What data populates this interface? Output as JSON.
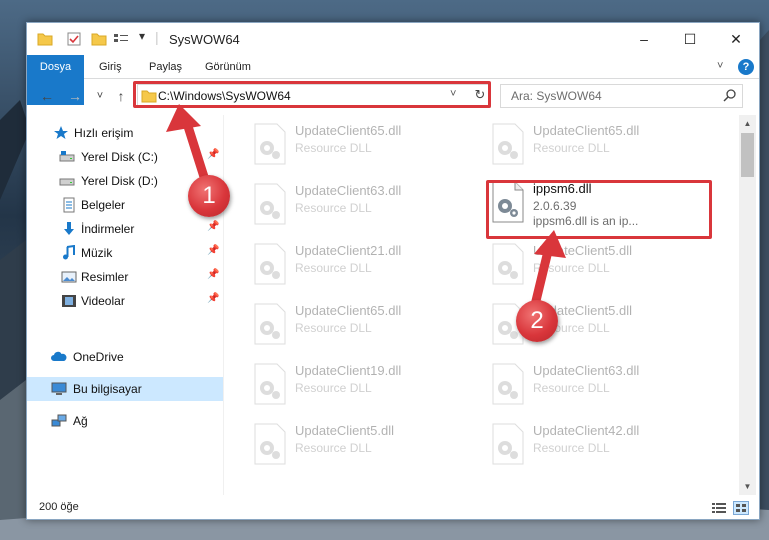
{
  "window": {
    "title": "SysWOW64",
    "minimize": "–",
    "maximize": "☐",
    "close": "✕"
  },
  "ribbon": {
    "tabs": [
      "Dosya",
      "Giriş",
      "Paylaş",
      "Görünüm"
    ],
    "help": "?"
  },
  "navigation": {
    "back": "←",
    "forward": "→",
    "recent": "˅",
    "up": "↑",
    "address": "C:\\Windows\\SysWOW64",
    "address_dropdown": "˅",
    "refresh": "↻",
    "search_placeholder": "Ara: SysWOW64"
  },
  "sidebar": {
    "items": [
      {
        "label": "Hızlı erişim",
        "icon": "star-icon"
      },
      {
        "label": "Yerel Disk (C:)",
        "icon": "drive-icon",
        "pinned": true
      },
      {
        "label": "Yerel Disk (D:)",
        "icon": "drive-icon",
        "pinned": false
      },
      {
        "label": "Belgeler",
        "icon": "document-icon",
        "pinned": true
      },
      {
        "label": "İndirmeler",
        "icon": "download-icon",
        "pinned": true
      },
      {
        "label": "Müzik",
        "icon": "music-icon",
        "pinned": true
      },
      {
        "label": "Resimler",
        "icon": "picture-icon",
        "pinned": true
      },
      {
        "label": "Videolar",
        "icon": "video-icon",
        "pinned": true
      },
      {
        "label": "OneDrive",
        "icon": "cloud-icon"
      },
      {
        "label": "Bu bilgisayar",
        "icon": "computer-icon",
        "selected": true
      },
      {
        "label": "Ağ",
        "icon": "network-icon"
      }
    ]
  },
  "files": {
    "left": [
      {
        "name": "UpdateClient65.dll",
        "desc": "Resource DLL"
      },
      {
        "name": "UpdateClient63.dll",
        "desc": "Resource DLL"
      },
      {
        "name": "UpdateClient21.dll",
        "desc": "Resource DLL"
      },
      {
        "name": "UpdateClient65.dll",
        "desc": "Resource DLL"
      },
      {
        "name": "UpdateClient19.dll",
        "desc": "Resource DLL"
      },
      {
        "name": "UpdateClient5.dll",
        "desc": "Resource DLL"
      }
    ],
    "right": [
      {
        "name": "UpdateClient65.dll",
        "desc": "Resource DLL"
      },
      {
        "name": "UpdateClient5.dll",
        "desc": "Resource DLL"
      },
      {
        "name": "UpdateClient5.dll",
        "desc": "Resource DLL"
      },
      {
        "name": "UpdateClient63.dll",
        "desc": "Resource DLL"
      },
      {
        "name": "UpdateClient42.dll",
        "desc": "Resource DLL"
      }
    ],
    "highlighted": {
      "name": "ippsm6.dll",
      "version": "2.0.6.39",
      "desc": "ippsm6.dll is an ip..."
    }
  },
  "status": {
    "count": "200 öğe"
  },
  "callouts": [
    "1",
    "2"
  ],
  "colors": {
    "accent": "#1979ca",
    "highlight_red": "#d9363b",
    "selected_bg": "#cce8ff"
  }
}
